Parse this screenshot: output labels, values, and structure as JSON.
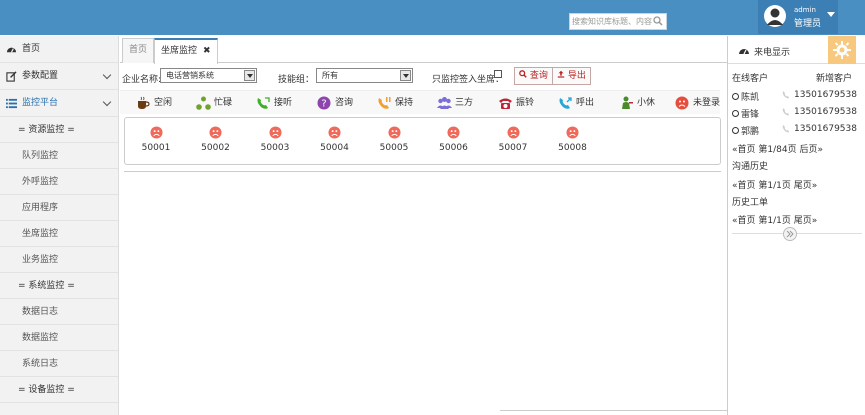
{
  "header": {
    "search_placeholder": "搜索知识库标题、内容",
    "user_name": "admin",
    "user_role": "管理员"
  },
  "sidebar": {
    "items": [
      {
        "label": "首页"
      },
      {
        "label": "参数配置"
      },
      {
        "label": "监控平台"
      },
      {
        "label": "= 资源监控 ="
      },
      {
        "label": "队列监控"
      },
      {
        "label": "外呼监控"
      },
      {
        "label": "应用程序"
      },
      {
        "label": "坐席监控"
      },
      {
        "label": "业务监控"
      },
      {
        "label": "= 系统监控 ="
      },
      {
        "label": "数据日志"
      },
      {
        "label": "数据监控"
      },
      {
        "label": "系统日志"
      },
      {
        "label": "= 设备监控 ="
      }
    ]
  },
  "tabs": [
    {
      "label": "首页"
    },
    {
      "label": "坐席监控"
    }
  ],
  "filter": {
    "company_label": "企业名称:",
    "company_value": "电话营销系统",
    "skill_label": "技能组：",
    "skill_value": "所有",
    "only_label": "只监控签入坐席：",
    "query_label": "查询",
    "export_label": "导出"
  },
  "legend": [
    {
      "label": "空闲",
      "icon": "idle-icon",
      "color": "#6a3c12"
    },
    {
      "label": "忙碌",
      "icon": "busy-icon",
      "color": "#6fa32b"
    },
    {
      "label": "接听",
      "icon": "answer-phone-icon",
      "color": "#3fae2a"
    },
    {
      "label": "咨询",
      "icon": "help-icon",
      "color": "#8e44ad"
    },
    {
      "label": "保持",
      "icon": "hold-phone-icon",
      "color": "#f0a030"
    },
    {
      "label": "三方",
      "icon": "conference-icon",
      "color": "#7b6ed6"
    },
    {
      "label": "振铃",
      "icon": "ringing-icon",
      "color": "#c0243a"
    },
    {
      "label": "呼出",
      "icon": "outbound-phone-icon",
      "color": "#2aa6d6"
    },
    {
      "label": "小休",
      "icon": "rest-icon",
      "color": "#4a8a2a"
    },
    {
      "label": "未登录",
      "icon": "offline-face-icon",
      "color": "#e74c3c"
    }
  ],
  "seats": [
    "50001",
    "50002",
    "50003",
    "50004",
    "50005",
    "50006",
    "50007",
    "50008"
  ],
  "rpanel": {
    "title": "来电显示",
    "online_label": "在线客户",
    "new_label": "新增客户",
    "customers": [
      {
        "name": "陈凯",
        "phone": "13501679538"
      },
      {
        "name": "雷锋",
        "phone": "13501679538"
      },
      {
        "name": "郭鹏",
        "phone": "13501679538"
      }
    ],
    "pager1": "«首页  第1/84页  后页»",
    "history_label": "沟通历史",
    "pager2": "«首页  第1/1页  尾页»",
    "ticket_label": "历史工单",
    "pager3": "«首页  第1/1页  尾页»"
  }
}
